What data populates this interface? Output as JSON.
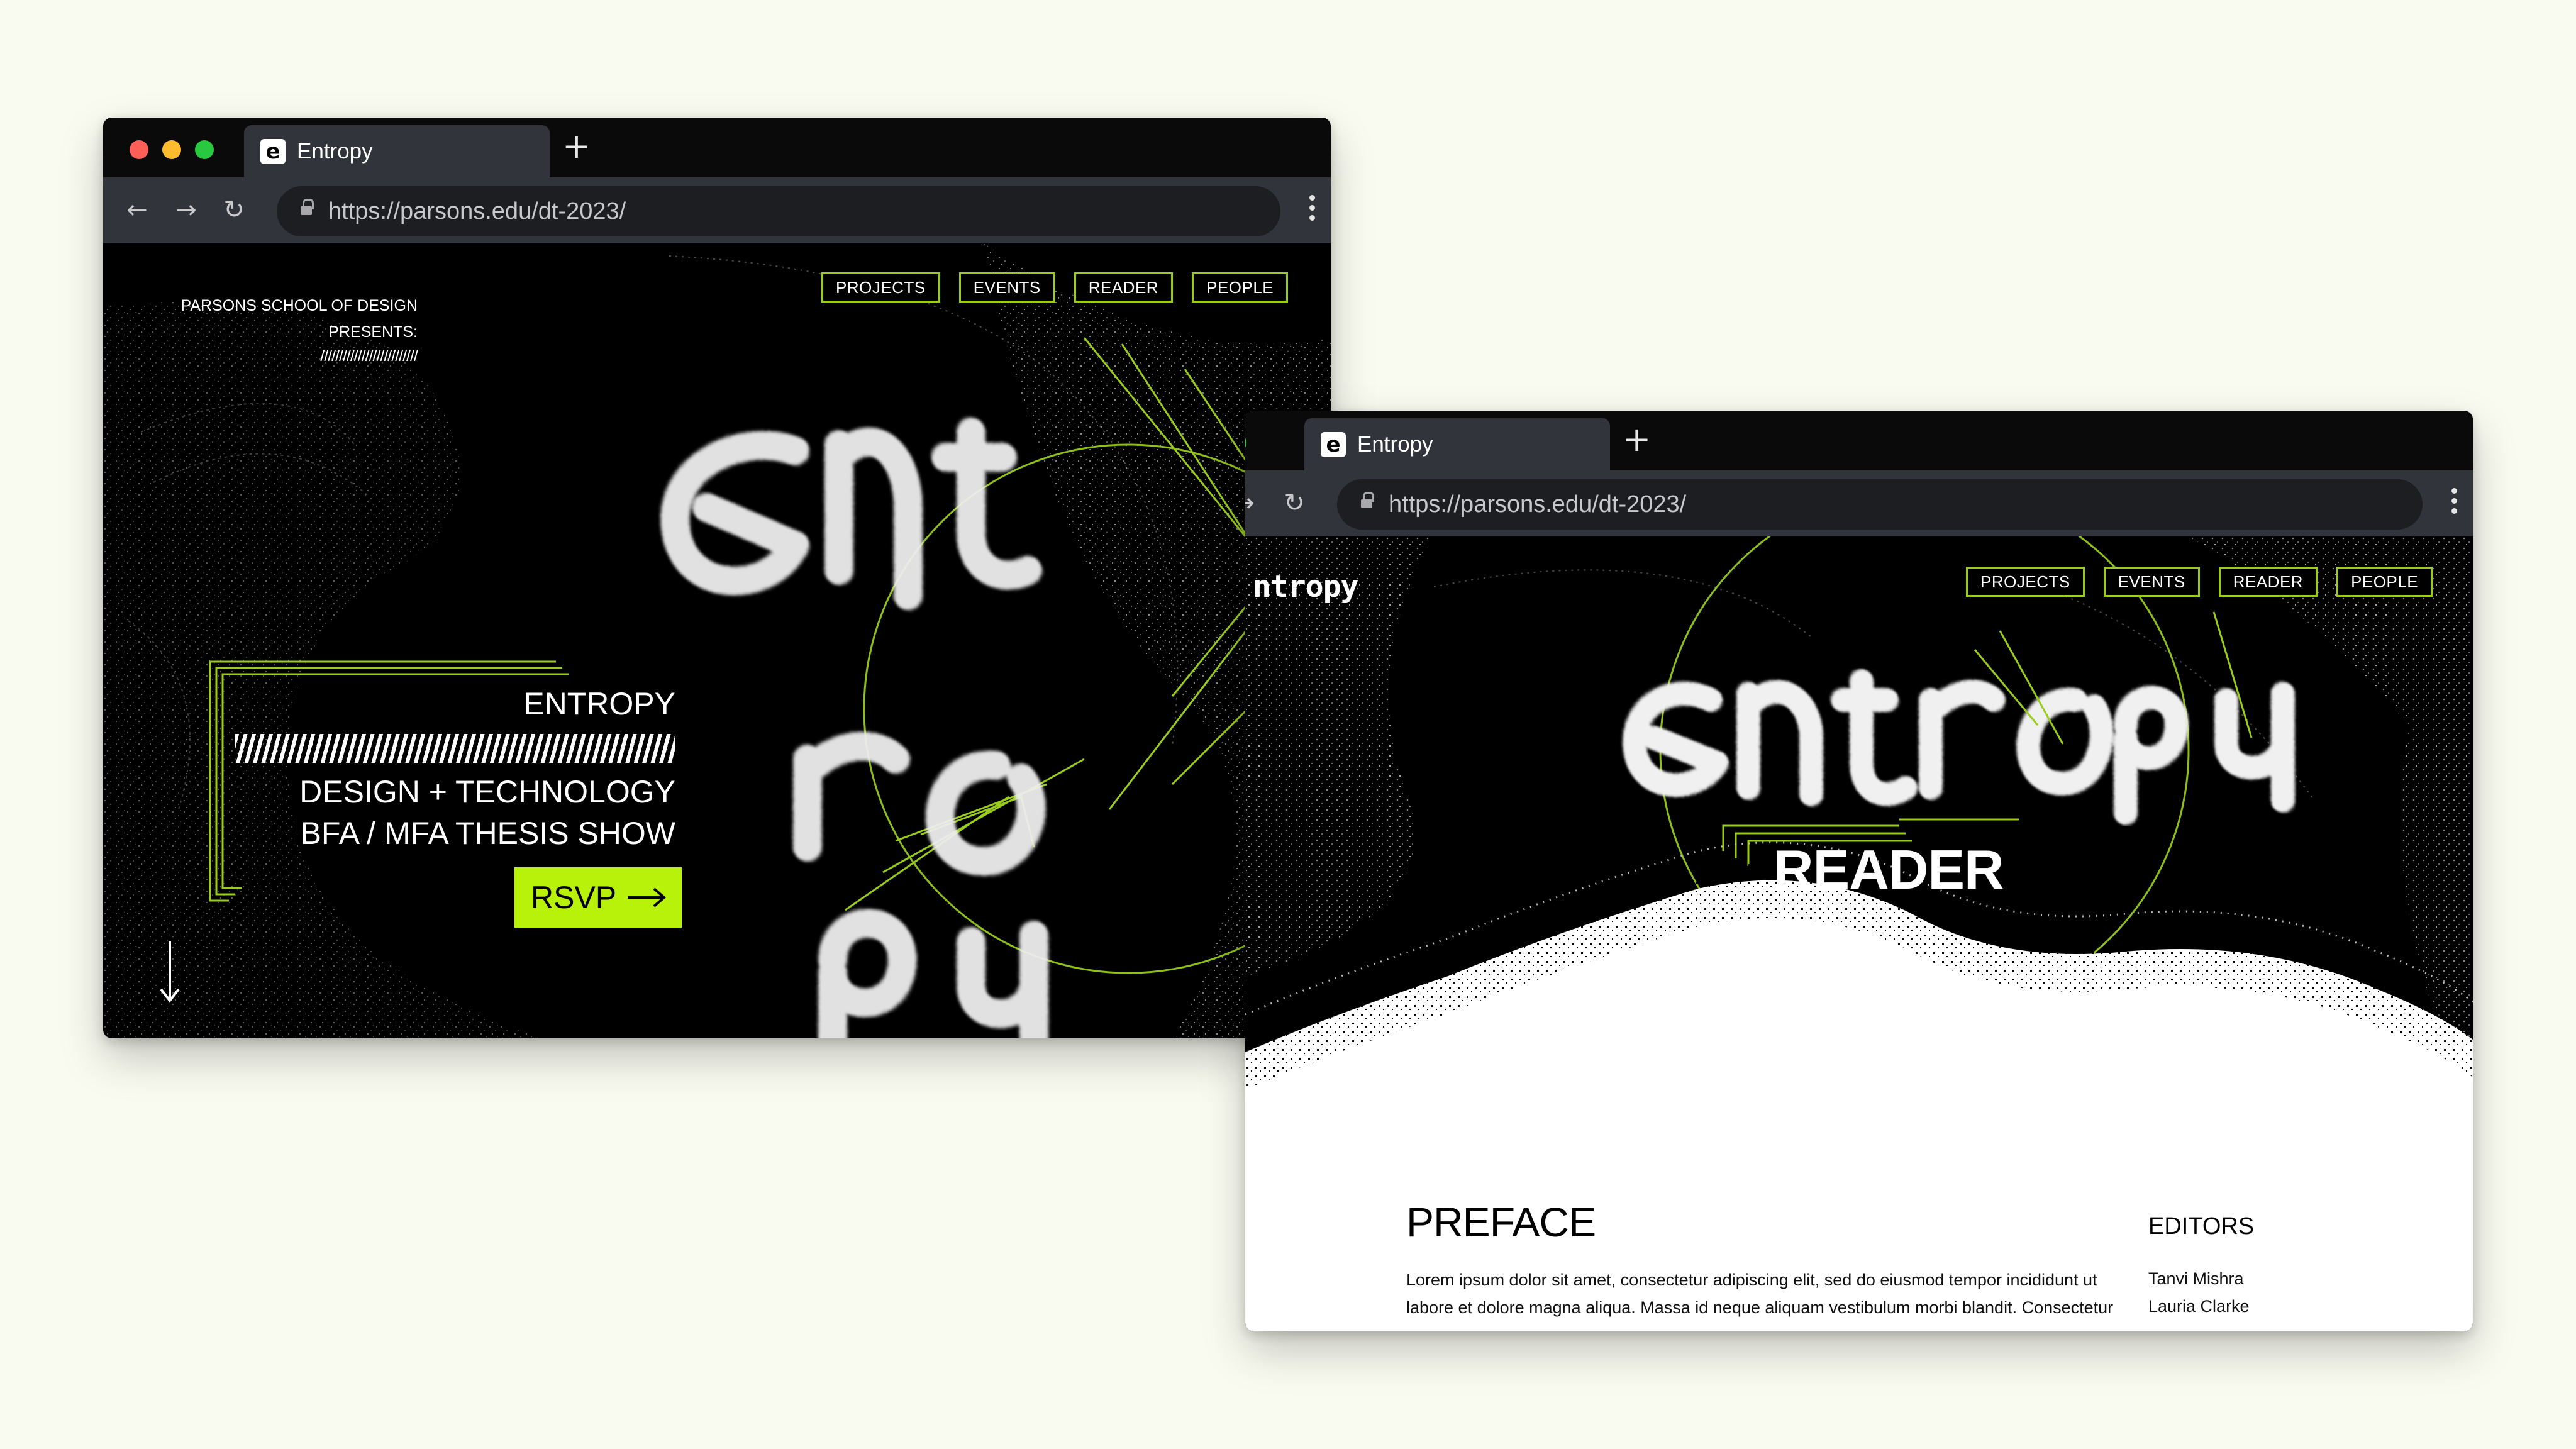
{
  "colors": {
    "background": "#f9fbf1",
    "accent": "#b8f20a",
    "outline_green": "#9acc1c",
    "dot_close": "#ff5f57",
    "dot_minimize": "#febc2e",
    "dot_zoom": "#28c840"
  },
  "window_home": {
    "tab": {
      "favicon": "entropy-e-icon",
      "title": "Entropy"
    },
    "new_tab_icon": "plus-icon",
    "toolbar": {
      "back_icon": "arrow-left-icon",
      "forward_icon": "arrow-right-icon",
      "reload_icon": "reload-icon",
      "url": "https://parsons.edu/dt-2023/"
    },
    "nav": [
      "PROJECTS",
      "EVENTS",
      "READER",
      "PEOPLE"
    ],
    "presents": {
      "line1": "PARSONS SCHOOL OF DESIGN",
      "line2": "PRESENTS:",
      "slashes": "//////////////////////////"
    },
    "hero": {
      "title": "ENTROPY",
      "line1": "DESIGN + TECHNOLOGY",
      "line2": "BFA / MFA THESIS SHOW",
      "cta": "RSVP"
    },
    "scroll_icon": "arrow-down-icon"
  },
  "window_reader": {
    "tab": {
      "favicon": "entropy-e-icon",
      "title": "Entropy"
    },
    "new_tab_icon": "plus-icon",
    "toolbar": {
      "url": "https://parsons.edu/dt-2023/"
    },
    "wordmark": "ntropy",
    "nav": [
      "PROJECTS",
      "EVENTS",
      "READER",
      "PEOPLE"
    ],
    "page_title": "READER",
    "preface": {
      "heading": "PREFACE",
      "body": "Lorem ipsum dolor sit amet, consectetur adipiscing elit, sed do eiusmod tempor incididunt ut labore et dolore magna aliqua. Massa id neque aliquam vestibulum morbi blandit. Consectetur a"
    },
    "editors": {
      "heading": "EDITORS",
      "names": [
        "Tanvi Mishra",
        "Lauria Clarke"
      ]
    }
  }
}
